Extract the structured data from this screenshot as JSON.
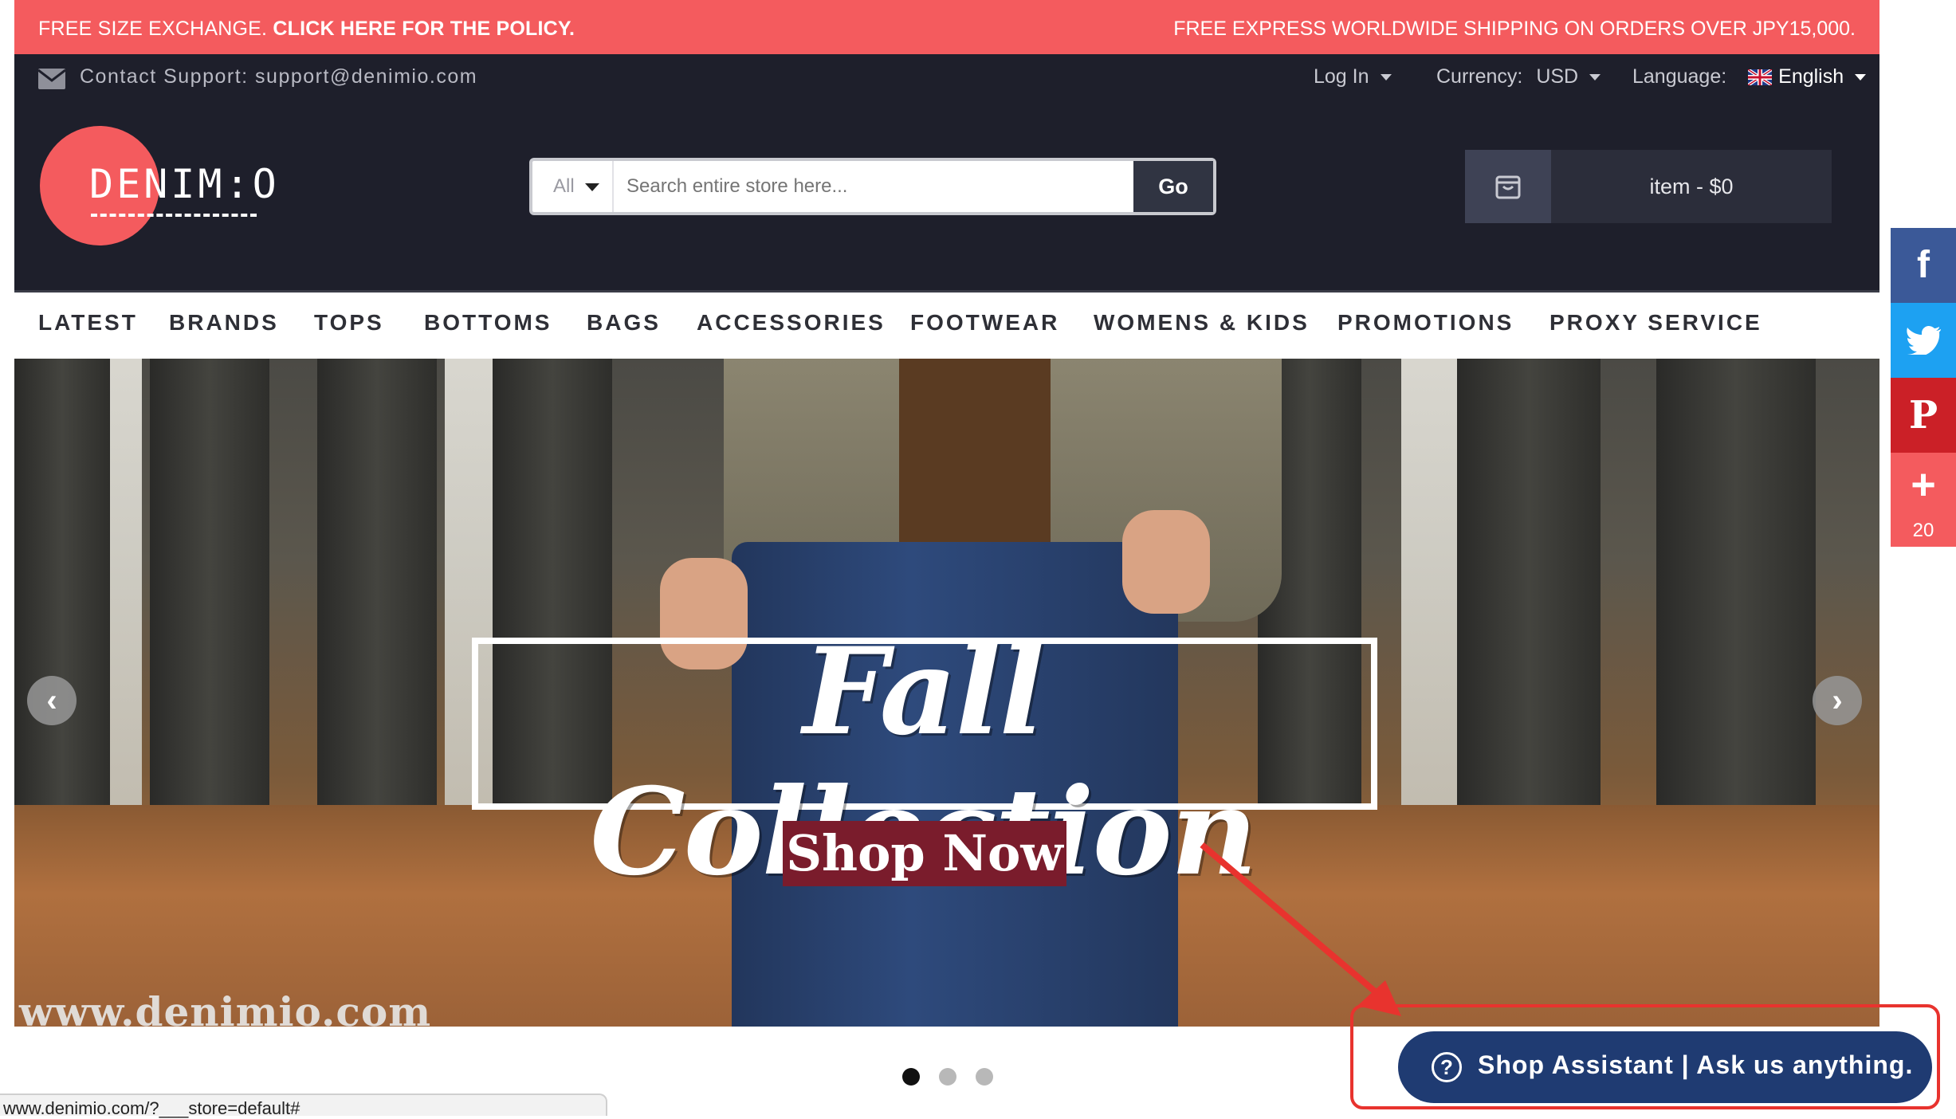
{
  "promo": {
    "left_text": "FREE SIZE EXCHANGE.",
    "left_link": "CLICK HERE FOR THE POLICY.",
    "right_text": "FREE EXPRESS WORLDWIDE SHIPPING ON ORDERS OVER JPY15,000."
  },
  "header": {
    "support_text": "Contact Support: support@denimio.com",
    "login_label": "Log In",
    "currency_label": "Currency:",
    "currency_value": "USD",
    "language_label": "Language:",
    "language_value": "English",
    "logo_text": "DENIM:O",
    "search": {
      "category": "All",
      "placeholder": "Search entire store here...",
      "go_label": "Go"
    },
    "cart_label": "item - $0"
  },
  "nav": {
    "items": [
      "LATEST",
      "BRANDS",
      "TOPS",
      "BOTTOMS",
      "BAGS",
      "ACCESSORIES",
      "FOOTWEAR",
      "WOMENS & KIDS",
      "PROMOTIONS",
      "PROXY SERVICE"
    ]
  },
  "hero": {
    "title": "Fall Collection",
    "cta": "Shop Now",
    "watermark": "www.denimio.com",
    "slides_total": 3,
    "active_slide": 1
  },
  "social": {
    "facebook_color": "#3b5998",
    "twitter_color": "#1da1f2",
    "pinterest_color": "#cb2027",
    "more_color": "#f45b5e",
    "share_count": "20"
  },
  "assistant": {
    "label": "Shop Assistant | Ask us anything."
  },
  "status_bar": {
    "url": "www.denimio.com/?___store=default#"
  },
  "colors": {
    "accent": "#f45b5e",
    "header_bg": "#1e1f2b",
    "assistant_bg": "#1f3b72"
  }
}
